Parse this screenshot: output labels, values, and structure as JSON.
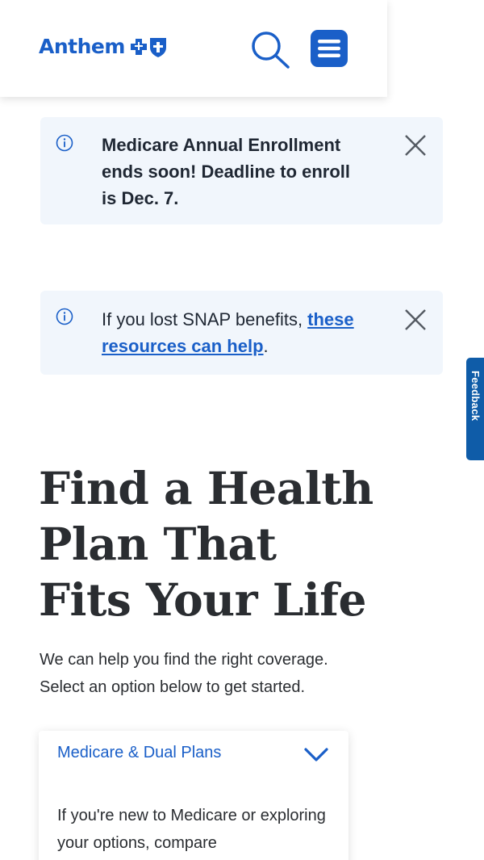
{
  "header": {
    "logo_text": "Anthem"
  },
  "alerts": [
    {
      "message": "Medicare Annual Enrollment ends soon! Deadline to enroll is Dec. 7."
    },
    {
      "message_prefix": "If you lost SNAP benefits, ",
      "link_text": "these resources can help",
      "message_suffix": "."
    }
  ],
  "feedback": {
    "label": "Feedback"
  },
  "hero": {
    "title": "Find a Health Plan That Fits Your Life",
    "subtitle": "We can help you find the right coverage. Select an option below to get started."
  },
  "plan_card": {
    "title": "Medicare & Dual Plans",
    "body": "If you're new to Medicare or exploring your options, compare"
  },
  "colors": {
    "brand_blue": "#1a5fc8",
    "alert_bg": "#f1f6fc",
    "feedback_tab": "#0f5ca8"
  }
}
